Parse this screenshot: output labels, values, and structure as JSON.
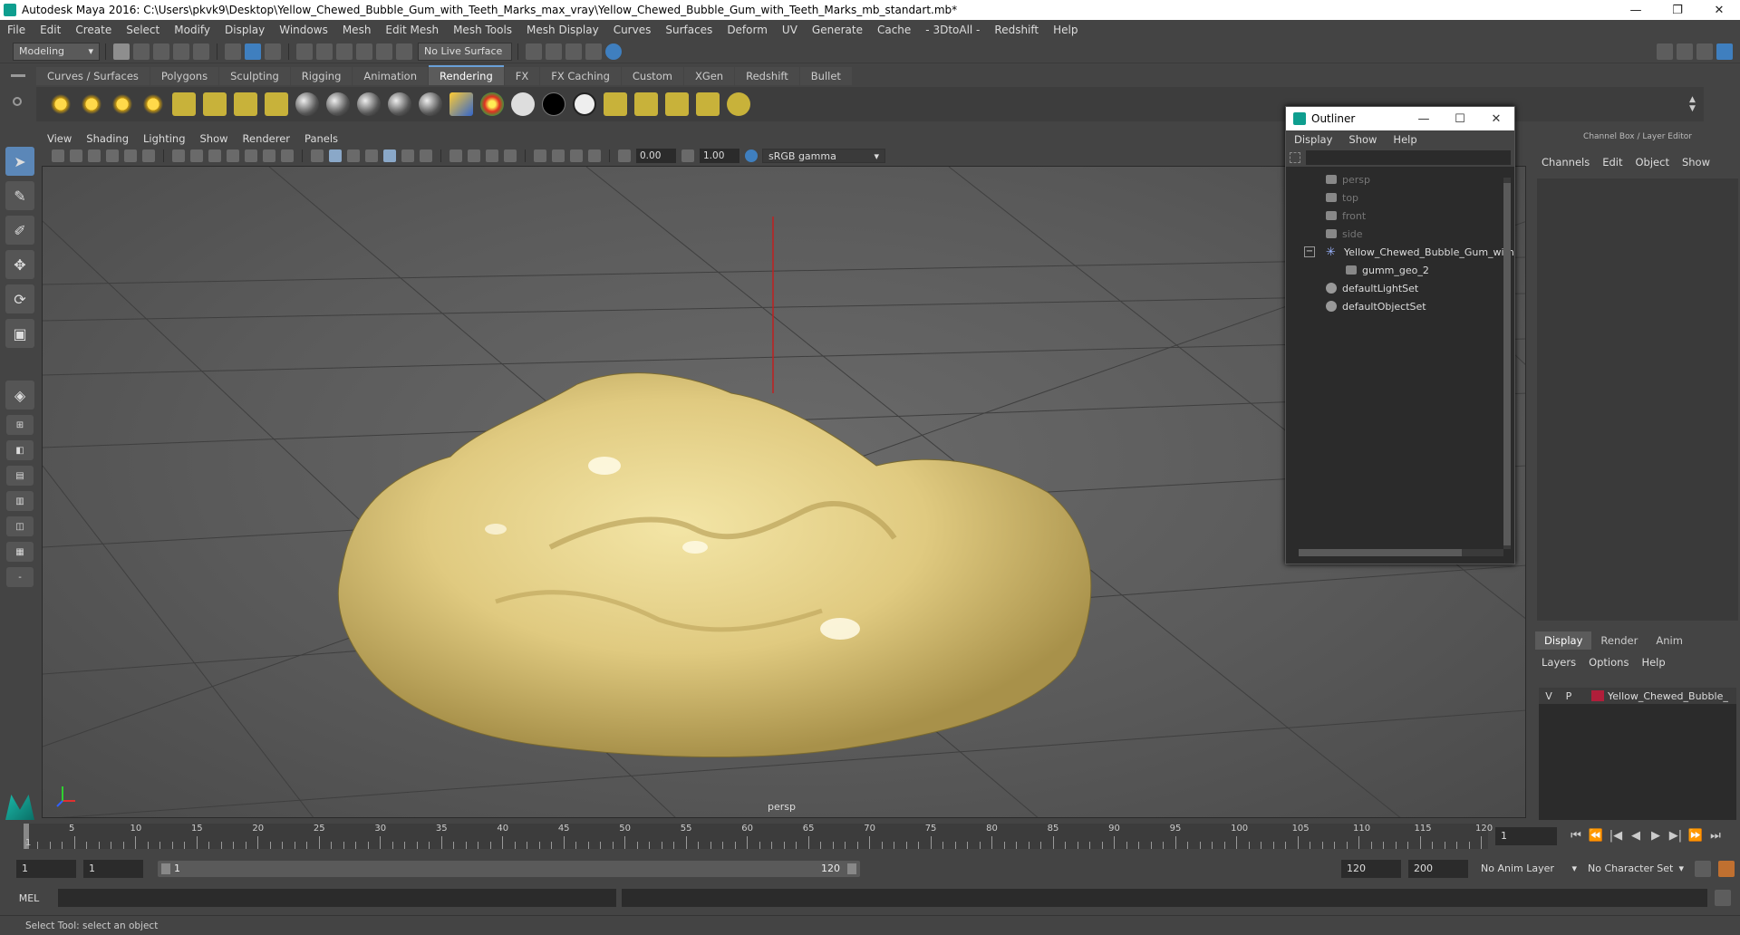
{
  "window": {
    "title": "Autodesk Maya 2016: C:\\Users\\pkvk9\\Desktop\\Yellow_Chewed_Bubble_Gum_with_Teeth_Marks_max_vray\\Yellow_Chewed_Bubble_Gum_with_Teeth_Marks_mb_standart.mb*",
    "minimize": "—",
    "maximize": "❐",
    "close": "✕"
  },
  "menubar": [
    "File",
    "Edit",
    "Create",
    "Select",
    "Modify",
    "Display",
    "Windows",
    "Mesh",
    "Edit Mesh",
    "Mesh Tools",
    "Mesh Display",
    "Curves",
    "Surfaces",
    "Deform",
    "UV",
    "Generate",
    "Cache",
    "- 3DtoAll -",
    "Redshift",
    "Help"
  ],
  "statusline": {
    "mode": "Modeling",
    "live_surface": "No Live Surface"
  },
  "shelf": {
    "tabs": [
      "Curves / Surfaces",
      "Polygons",
      "Sculpting",
      "Rigging",
      "Animation",
      "Rendering",
      "FX",
      "FX Caching",
      "Custom",
      "XGen",
      "Redshift",
      "Bullet"
    ],
    "active_tab": "Rendering"
  },
  "viewport": {
    "menu": [
      "View",
      "Shading",
      "Lighting",
      "Show",
      "Renderer",
      "Panels"
    ],
    "exposure": "0.00",
    "gamma": "1.00",
    "color_space": "sRGB gamma",
    "camera_label": "persp"
  },
  "outliner": {
    "title": "Outliner",
    "menu": [
      "Display",
      "Show",
      "Help"
    ],
    "items": [
      {
        "label": "persp",
        "type": "camera",
        "dim": true
      },
      {
        "label": "top",
        "type": "camera",
        "dim": true
      },
      {
        "label": "front",
        "type": "camera",
        "dim": true
      },
      {
        "label": "side",
        "type": "camera",
        "dim": true
      },
      {
        "label": "Yellow_Chewed_Bubble_Gum_with",
        "type": "group",
        "dim": false
      },
      {
        "label": "gumm_geo_2",
        "type": "mesh",
        "dim": false
      },
      {
        "label": "defaultLightSet",
        "type": "set",
        "dim": false
      },
      {
        "label": "defaultObjectSet",
        "type": "set",
        "dim": false
      }
    ]
  },
  "channelbox": {
    "title": "Channel Box / Layer Editor",
    "menu": [
      "Channels",
      "Edit",
      "Object",
      "Show"
    ],
    "tabs": [
      "Display",
      "Render",
      "Anim"
    ],
    "active_tab": "Display",
    "layer_menu": [
      "Layers",
      "Options",
      "Help"
    ],
    "layer": {
      "v": "V",
      "p": "P",
      "name": "Yellow_Chewed_Bubble_",
      "color": "#b01e3a"
    }
  },
  "timeline": {
    "start": 1,
    "end": 120,
    "labels": [
      "5",
      "10",
      "15",
      "20",
      "25",
      "30",
      "35",
      "40",
      "45",
      "50",
      "55",
      "60",
      "65",
      "70",
      "75",
      "80",
      "85",
      "90",
      "95",
      "100",
      "105",
      "110",
      "115",
      "120"
    ],
    "current_frame": "1",
    "first_label": "1"
  },
  "range": {
    "start_field": "1",
    "playback_start": "1",
    "slider_start": "1",
    "slider_end": "120",
    "playback_end": "120",
    "end_field": "200",
    "anim_layer": "No Anim Layer",
    "character_set": "No Character Set"
  },
  "command": {
    "mel_label": "MEL",
    "help_text": "Select Tool: select an object"
  }
}
